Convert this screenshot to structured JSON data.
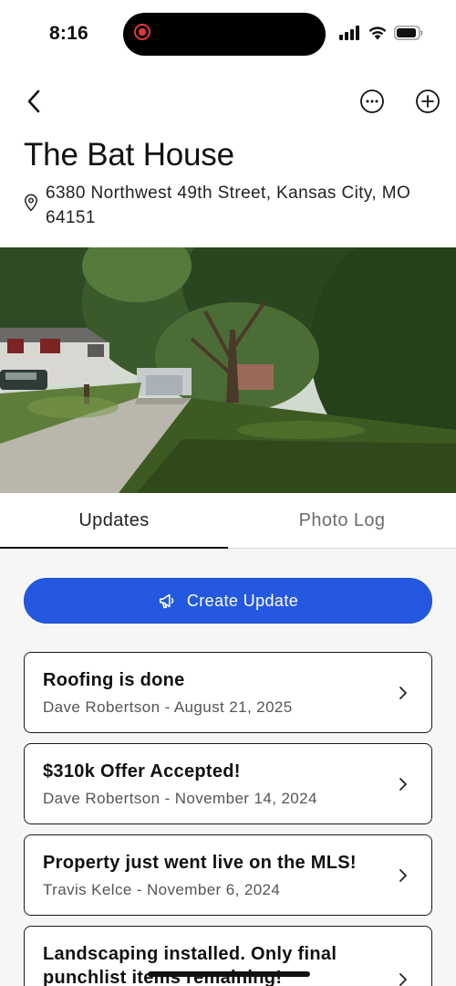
{
  "status_bar": {
    "time": "8:16"
  },
  "header": {
    "title": "The Bat House",
    "address": "6380 Northwest 49th Street, Kansas City, MO 64151"
  },
  "tabs": [
    {
      "label": "Updates",
      "active": true
    },
    {
      "label": "Photo Log",
      "active": false
    }
  ],
  "actions": {
    "create_update_label": "Create Update"
  },
  "updates": [
    {
      "title": "Roofing is done",
      "meta": "Dave Robertson - August 21, 2025"
    },
    {
      "title": "$310k Offer Accepted!",
      "meta": "Dave Robertson - November 14, 2024"
    },
    {
      "title": "Property just went live on the MLS!",
      "meta": "Travis Kelce - November 6, 2024"
    },
    {
      "title": "Landscaping installed. Only final punchlist items remaining!",
      "meta": ""
    }
  ],
  "icons": {
    "back": "chevron-left-icon",
    "more": "ellipsis-circle-icon",
    "add": "plus-circle-icon",
    "location": "map-pin-icon",
    "create": "megaphone-icon",
    "row": "chevron-right-icon"
  },
  "colors": {
    "accent": "#2458e0",
    "record": "#e4383a",
    "card_border": "#1a1a1a",
    "content_bg": "#f6f6f6"
  }
}
